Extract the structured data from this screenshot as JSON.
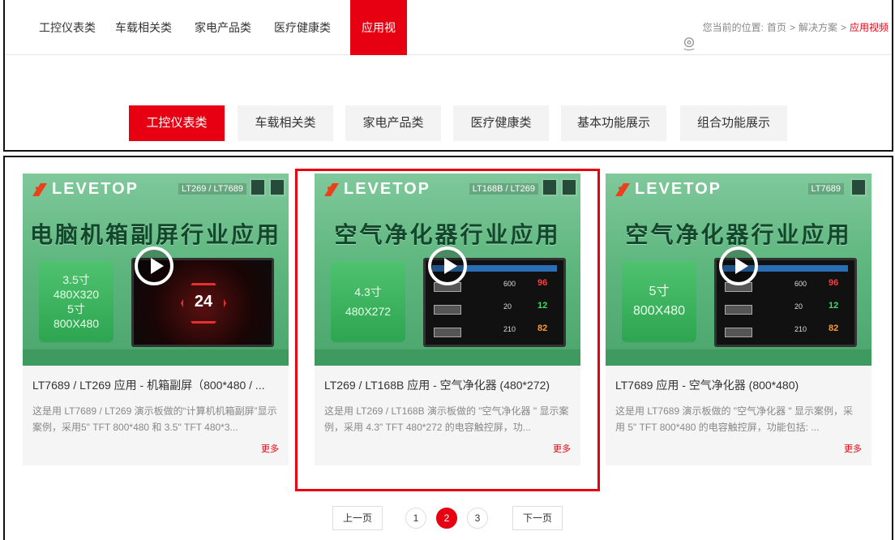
{
  "nav": {
    "items": [
      "工控仪表类",
      "车载相关类",
      "家电产品类",
      "医疗健康类",
      "应用视频"
    ],
    "active_index": 4
  },
  "location": {
    "icon": "location-pin-icon",
    "prefix": "您当前的位置:",
    "home": "首页",
    "sep1": ">",
    "solutions": "解决方案",
    "sep2": ">",
    "current": "应用视频"
  },
  "categories": {
    "items": [
      "工控仪表类",
      "车载相关类",
      "家电产品类",
      "医疗健康类",
      "基本功能展示",
      "组合功能展示"
    ],
    "active_index": 0
  },
  "cards": [
    {
      "logo": "LEVETOP",
      "chip_label": "LT269 / LT7689",
      "headline": "电脑机箱副屏行业应用",
      "spec_lines": [
        "3.5寸",
        "480X320",
        "5寸",
        "800X480"
      ],
      "screen_value": "24",
      "title": "LT7689 / LT269 应用 - 机箱副屏（800*480 / ...",
      "desc": "这是用 LT7689 / LT269 演示板做的“计算机机箱副屏”显示案例，采用5\" TFT 800*480 和 3.5\" TFT 480*3...",
      "more": "更多"
    },
    {
      "logo": "LEVETOP",
      "chip_label": "LT168B / LT269",
      "headline": "空气净化器行业应用",
      "spec_lines": [
        "4.3寸",
        "480X272"
      ],
      "screen_rows": [
        {
          "val": "600",
          "pct": "96"
        },
        {
          "val": "20",
          "pct": "12"
        },
        {
          "val": "210",
          "pct": "82"
        }
      ],
      "title": "LT269 / LT168B 应用 - 空气净化器 (480*272)",
      "desc": "这是用 LT269 / LT168B 演示板做的 \"空气净化器 \" 显示案例，采用 4.3\" TFT 480*272 的电容触控屏，功...",
      "more": "更多"
    },
    {
      "logo": "LEVETOP",
      "chip_label": "LT7689",
      "headline": "空气净化器行业应用",
      "spec_lines": [
        "5寸",
        "800X480"
      ],
      "screen_rows": [
        {
          "val": "600",
          "pct": "96"
        },
        {
          "val": "20",
          "pct": "12"
        },
        {
          "val": "210",
          "pct": "82"
        }
      ],
      "title": "LT7689 应用 - 空气净化器 (800*480)",
      "desc": "这是用 LT7689 演示板做的 \"空气净化器 \" 显示案例，采用 5\" TFT 800*480 的电容触控屏，功能包括: ...",
      "more": "更多"
    }
  ],
  "pager": {
    "prev": "上一页",
    "pages": [
      "1",
      "2",
      "3"
    ],
    "current": "2",
    "next": "下一页"
  },
  "colors": {
    "accent": "#e60012",
    "pct_red": "#ff3b3b",
    "pct_green": "#3ddc6b",
    "pct_orange": "#ff9a2e"
  }
}
